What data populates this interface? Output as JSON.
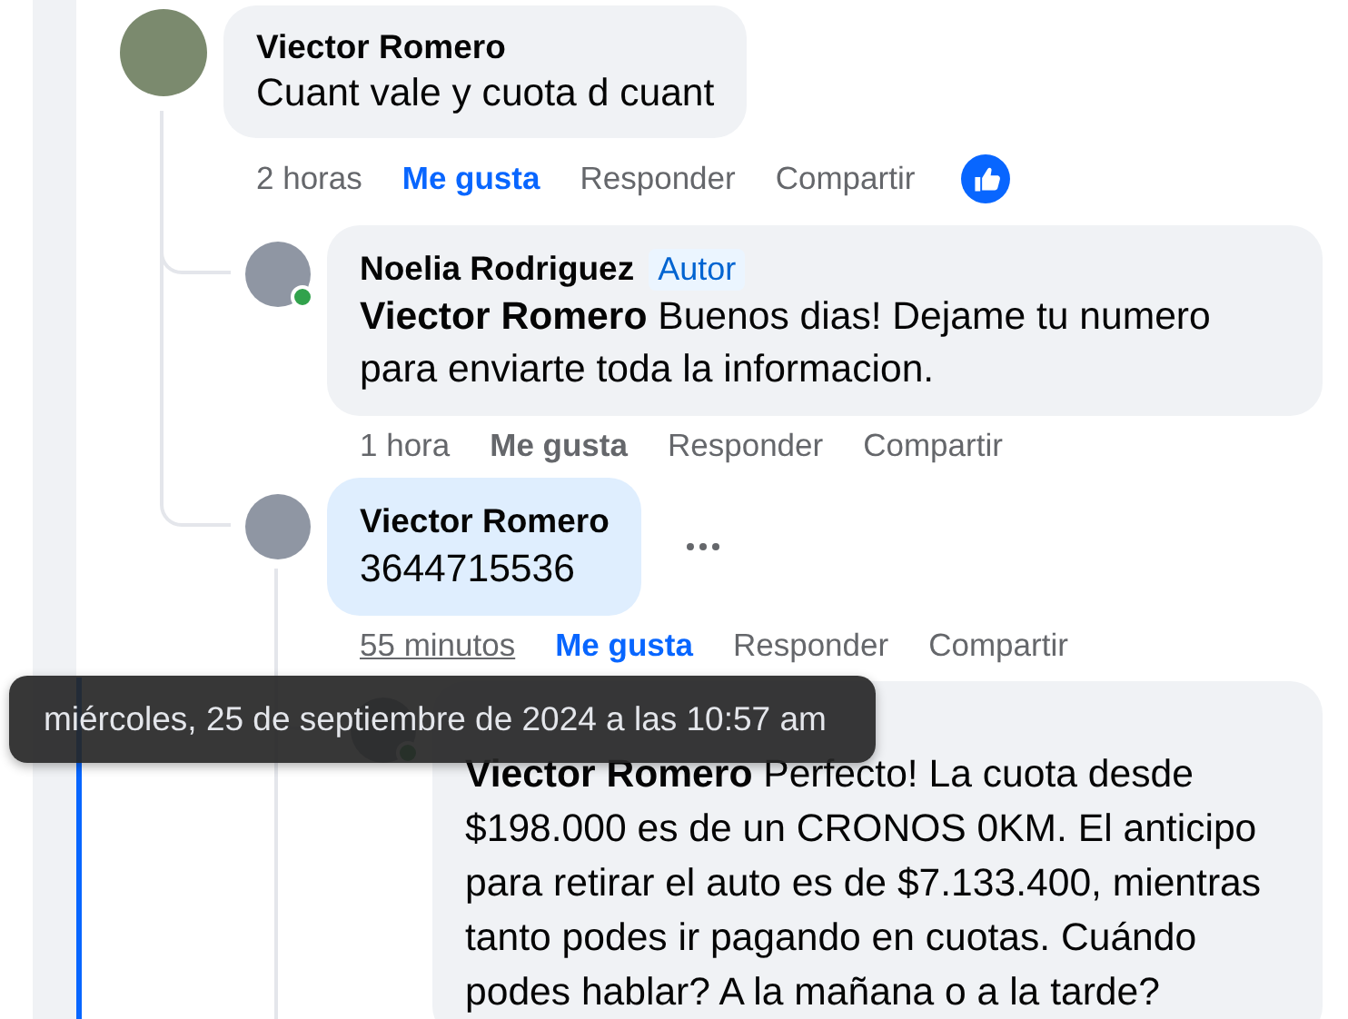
{
  "comments": [
    {
      "author": "Viector Romero",
      "text": "Cuant vale y cuota d cuant",
      "online": false,
      "highlighted": false,
      "show_more_button": false,
      "has_like_reaction": true,
      "actions": {
        "time": "2 horas",
        "time_underlined": false,
        "like": "Me gusta",
        "like_selected": true,
        "reply": "Responder",
        "share": "Compartir"
      },
      "children": [
        {
          "author": "Noelia Rodriguez",
          "author_badge": "Autor",
          "text": "**Viector Romero** Buenos dias! Dejame tu numero para enviarte toda la informacion.",
          "online": true,
          "highlighted": false,
          "show_more_button": false,
          "has_like_reaction": false,
          "actions": {
            "time": "1 hora",
            "time_underlined": false,
            "like": "Me gusta",
            "like_selected": false,
            "reply": "Responder",
            "share": "Compartir"
          }
        },
        {
          "author": "Viector Romero",
          "text": "3644715536",
          "online": false,
          "highlighted": true,
          "show_more_button": true,
          "has_like_reaction": false,
          "actions": {
            "time": "55 minutos",
            "time_underlined": true,
            "like": "Me gusta",
            "like_selected": true,
            "reply": "Responder",
            "share": "Compartir"
          },
          "children": [
            {
              "text": "**Viector Romero** Perfecto! La cuota desde $198.000 es de un CRONOS 0KM. El anticipo para retirar el auto es de $7.133.400, mientras tanto podes ir pagando en cuotas. Cuándo podes hablar? A la mañana o a la tarde?",
              "online": true,
              "highlighted": false,
              "show_more_button": false,
              "has_like_reaction": false
            }
          ]
        }
      ]
    }
  ],
  "tooltip": {
    "text": "miércoles, 25 de septiembre de 2024 a las 10:57 am"
  }
}
